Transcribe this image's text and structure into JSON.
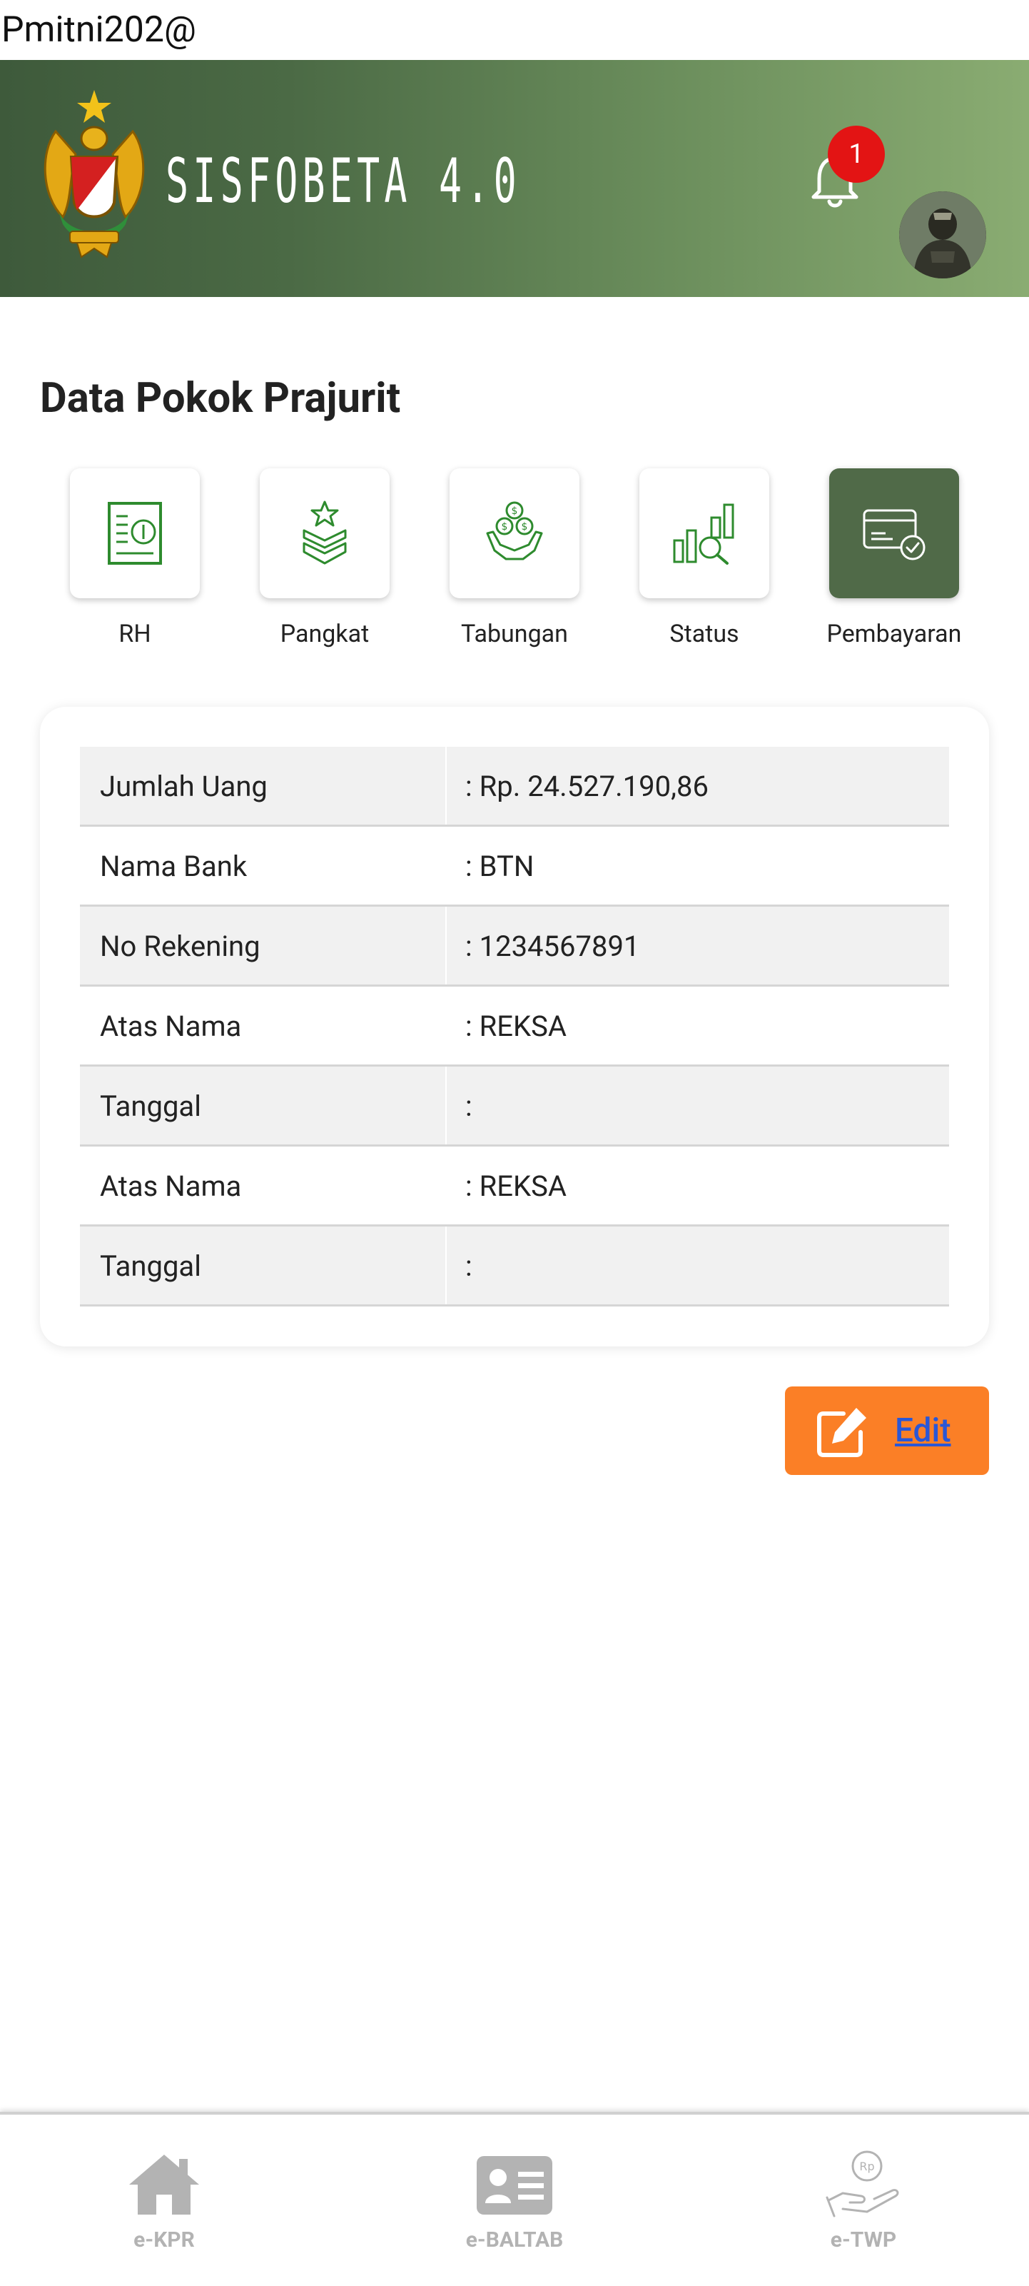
{
  "topline": {
    "text": "Pmitni202@"
  },
  "header": {
    "brand": "SISFOBETA 4.0",
    "notification_count": "1"
  },
  "section": {
    "title": "Data Pokok Prajurit"
  },
  "menu": [
    {
      "label": "RH",
      "icon": "document-icon"
    },
    {
      "label": "Pangkat",
      "icon": "rank-icon"
    },
    {
      "label": "Tabungan",
      "icon": "savings-icon"
    },
    {
      "label": "Status",
      "icon": "status-chart-icon"
    },
    {
      "label": "Pembayaran",
      "icon": "payment-card-icon"
    }
  ],
  "details": [
    {
      "label": "Jumlah Uang",
      "value": ": Rp. 24.527.190,86"
    },
    {
      "label": "Nama Bank",
      "value": ": BTN"
    },
    {
      "label": "No Rekening",
      "value": ": 1234567891"
    },
    {
      "label": "Atas Nama",
      "value": ": REKSA"
    },
    {
      "label": "Tanggal",
      "value": ":"
    },
    {
      "label": "Atas Nama",
      "value": ": REKSA"
    },
    {
      "label": "Tanggal",
      "value": ":"
    }
  ],
  "actions": {
    "edit_label": "Edit"
  },
  "bottom_nav": [
    {
      "label": "e-KPR",
      "icon": "home-icon"
    },
    {
      "label": "e-BALTAB",
      "icon": "id-card-icon"
    },
    {
      "label": "e-TWP",
      "icon": "hand-coin-icon"
    }
  ],
  "icon_badge_text": "Rp",
  "colors": {
    "header_start": "#3e5a3b",
    "header_end": "#8aac72",
    "accent_green": "#2e8b2e",
    "active_tile": "#506a48",
    "edit_button": "#fb7f26",
    "edit_text": "#2a57d6",
    "badge": "#e31414",
    "nav_inactive": "#b3b3b3"
  }
}
